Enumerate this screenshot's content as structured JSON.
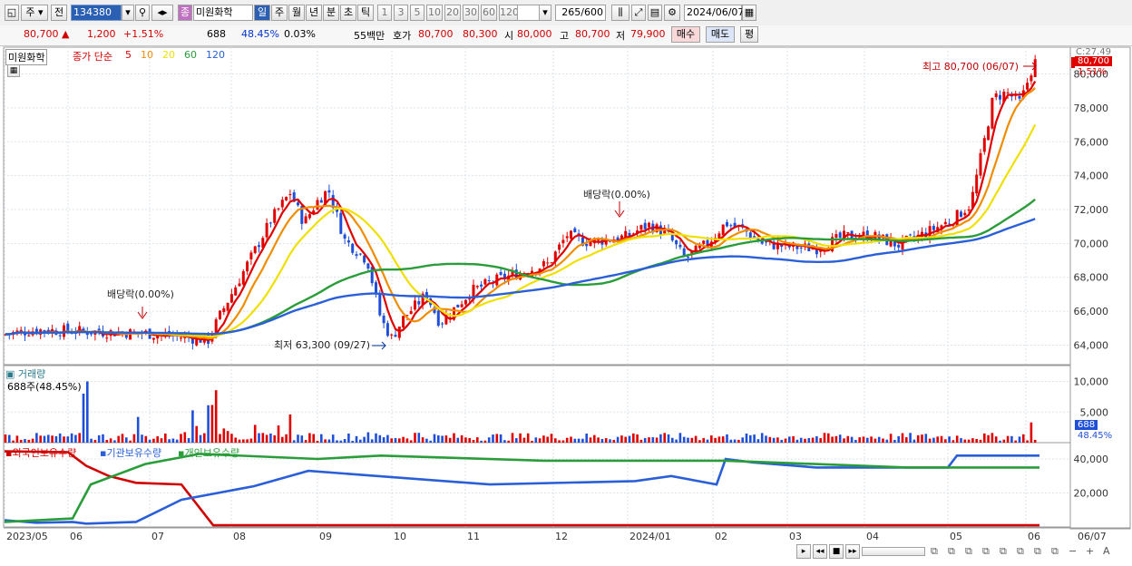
{
  "toolbar": {
    "period_unit": "주",
    "prev_label": "전",
    "code": "134380",
    "name_badge": "종",
    "stock_name": "미원화학",
    "periods": [
      "일",
      "주",
      "월",
      "년",
      "분",
      "초",
      "틱"
    ],
    "intervals": [
      "1",
      "3",
      "5",
      "10",
      "20",
      "30",
      "60",
      "120"
    ],
    "count": "265",
    "count_total": "/600",
    "date": "2024/06/07"
  },
  "quote": {
    "price": "80,700",
    "arrow": "▲",
    "change": "1,200",
    "pct": "+1.51%",
    "volume": "688",
    "vol_ratio": "48.45%",
    "turnover": "0.03%",
    "amount": "55백만",
    "ask_label": "호가",
    "ask": "80,700",
    "bid": "80,300",
    "open_label": "시",
    "open": "80,000",
    "high_label": "고",
    "high": "80,700",
    "low_label": "저",
    "low": "79,900",
    "buy_btn": "매수",
    "sell_btn": "매도",
    "eval_btn": "평"
  },
  "price_panel": {
    "name": "미원화학",
    "ma_title": "종가 단순",
    "ma_periods": [
      "5",
      "10",
      "20",
      "60",
      "120"
    ],
    "ma_colors": [
      "#e00000",
      "#f08c00",
      "#f0e000",
      "#2a9d3a",
      "#2a5fd8"
    ],
    "yticks": [
      "80,000",
      "78,000",
      "76,000",
      "74,000",
      "72,000",
      "70,000",
      "68,000",
      "66,000",
      "64,000"
    ],
    "top_clip": "C:27.49",
    "last_price_tag": "80,700",
    "last_pct_tag": "1.51%",
    "high_annot": "최고 80,700 (06/07)",
    "low_annot": "최저 63,300 (09/27)",
    "dividend1": "배당락(0.00%)",
    "dividend2": "배당락(0.00%)"
  },
  "volume_panel": {
    "title": "거래량",
    "sub": "688주(48.45%)",
    "yticks": [
      "10,000",
      "5,000"
    ],
    "tag_vol": "688",
    "tag_pct": "48.45%"
  },
  "holding_panel": {
    "series": [
      "외국인보유수량",
      "기관보유수량",
      "개인보유수량"
    ],
    "colors": [
      "#d00000",
      "#2a5fd8",
      "#2a9d3a"
    ],
    "yticks": [
      "40,000",
      "20,000"
    ]
  },
  "xaxis": {
    "labels": [
      "2023/05",
      "06",
      "07",
      "08",
      "09",
      "10",
      "11",
      "12",
      "2024/01",
      "02",
      "03",
      "04",
      "05",
      "06",
      "06/07"
    ]
  },
  "colors": {
    "up": "#e00000",
    "down": "#1f4fd8",
    "grid": "#dde3ea"
  }
}
